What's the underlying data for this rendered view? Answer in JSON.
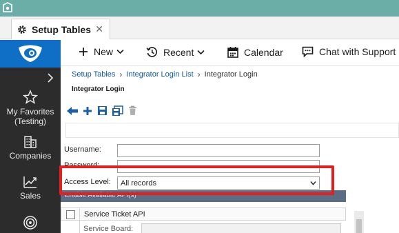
{
  "colors": {
    "top_strip": "#6aaea7",
    "sidebar_bg": "#2c2c2c",
    "logo_bg": "#0f6fc6",
    "link": "#0d5aa7",
    "section_bar": "#5a6d84",
    "highlight": "#e41f1f"
  },
  "tab": {
    "title": "Setup Tables",
    "close": "✕",
    "icon": "gear-icon"
  },
  "sidebar": {
    "items": [
      {
        "label": "My Favorites (Testing)",
        "icon": "star-icon"
      },
      {
        "label": "Companies",
        "icon": "building-icon"
      },
      {
        "label": "Sales",
        "icon": "chart-icon"
      },
      {
        "label": "",
        "icon": "target-icon"
      }
    ]
  },
  "nav": {
    "new": "New",
    "recent": "Recent",
    "calendar": "Calendar",
    "chat": "Chat with Support"
  },
  "breadcrumb": {
    "items": [
      "Setup Tables",
      "Integrator Login List",
      "Integrator Login"
    ],
    "separator": "›"
  },
  "page": {
    "title": "Integrator Login"
  },
  "toolbar": {
    "icons": [
      "back-arrow-icon",
      "add-icon",
      "save-icon",
      "save-and-new-icon",
      "delete-icon"
    ]
  },
  "form": {
    "username_label": "Username:",
    "username_value": "",
    "password_label": "Password:",
    "password_value": "",
    "access_level_label": "Access Level:",
    "access_level_value": "All records"
  },
  "section": {
    "title": "Enable Available API(s)"
  },
  "api_list": {
    "items": [
      {
        "label": "Service Ticket API",
        "checked": false
      }
    ],
    "service_board_label": "Service Board:",
    "service_board_value": ""
  }
}
